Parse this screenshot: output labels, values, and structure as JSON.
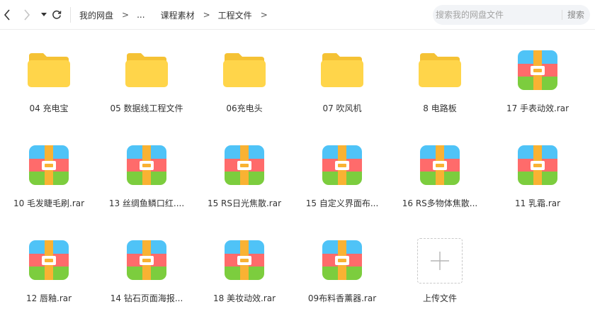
{
  "toolbar": {
    "back_icon": "chevron-left-icon",
    "forward_icon": "chevron-right-icon",
    "history_icon": "triangle-down-icon",
    "refresh_icon": "refresh-icon"
  },
  "breadcrumb": {
    "items": [
      "我的网盘",
      "...",
      "课程素材",
      "工程文件"
    ],
    "separator": ">"
  },
  "search": {
    "placeholder": "搜索我的网盘文件",
    "button_label": "搜索"
  },
  "colors": {
    "folder": "#ffd54a",
    "folder_tab": "#f5c234",
    "archive_top": "#4fc3f7",
    "archive_middle": "#ff6b6b",
    "archive_bottom": "#7ccd3e",
    "archive_strap": "#f9b233"
  },
  "files": [
    {
      "name": "04 充电宝",
      "type": "folder"
    },
    {
      "name": "05 数据线工程文件",
      "type": "folder"
    },
    {
      "name": "06充电头",
      "type": "folder"
    },
    {
      "name": "07 吹风机",
      "type": "folder"
    },
    {
      "name": "8 电路板",
      "type": "folder"
    },
    {
      "name": "17 手表动效.rar",
      "type": "archive"
    },
    {
      "name": "10 毛发睫毛刷.rar",
      "type": "archive"
    },
    {
      "name": "13 丝绸鱼鳞口红....",
      "type": "archive"
    },
    {
      "name": "15 RS日光焦散.rar",
      "type": "archive"
    },
    {
      "name": "15 自定义界面布...",
      "type": "archive"
    },
    {
      "name": "16 RS多物体焦散...",
      "type": "archive"
    },
    {
      "name": "11 乳霜.rar",
      "type": "archive"
    },
    {
      "name": "12 唇釉.rar",
      "type": "archive"
    },
    {
      "name": "14 钻石页面海报...",
      "type": "archive"
    },
    {
      "name": "18 美妆动效.rar",
      "type": "archive"
    },
    {
      "name": "09布料香薰器.rar",
      "type": "archive"
    }
  ],
  "upload": {
    "label": "上传文件",
    "icon": "plus-icon"
  }
}
